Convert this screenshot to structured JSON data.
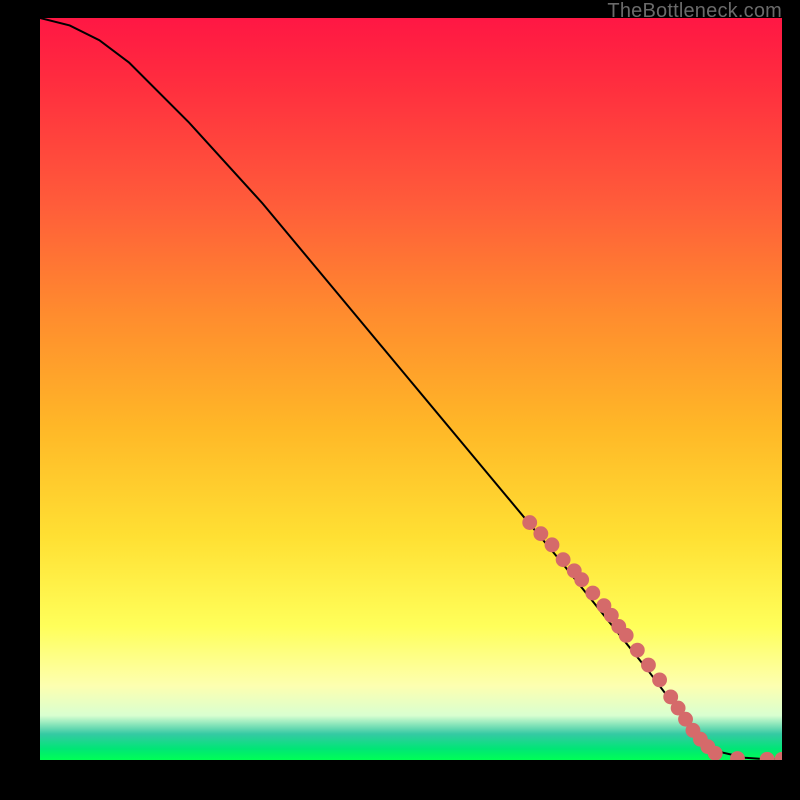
{
  "attribution": "TheBottleneck.com",
  "chart_data": {
    "type": "line",
    "title": "",
    "xlabel": "",
    "ylabel": "",
    "xlim": [
      0,
      100
    ],
    "ylim": [
      0,
      100
    ],
    "grid": false,
    "legend": false,
    "series": [
      {
        "name": "curve",
        "color": "#000000",
        "x": [
          0,
          4,
          8,
          12,
          20,
          30,
          40,
          50,
          60,
          70,
          78,
          82,
          85,
          88,
          90,
          92,
          95,
          98,
          100
        ],
        "y": [
          100,
          99,
          97,
          94,
          86,
          75,
          63,
          51,
          39,
          27,
          17,
          12,
          8,
          4,
          2,
          1,
          0.3,
          0.1,
          0.1
        ]
      },
      {
        "name": "highlight-dots",
        "color": "#d56a6a",
        "type": "scatter",
        "x": [
          66,
          67.5,
          69,
          70.5,
          72,
          73,
          74.5,
          76,
          77,
          78,
          79,
          80.5,
          82,
          83.5,
          85,
          86,
          87,
          88,
          89,
          90,
          91,
          94,
          98,
          100
        ],
        "y": [
          32,
          30.5,
          29,
          27,
          25.5,
          24.3,
          22.5,
          20.8,
          19.5,
          18,
          16.8,
          14.8,
          12.8,
          10.8,
          8.5,
          7,
          5.5,
          4,
          2.8,
          1.8,
          0.9,
          0.2,
          0.1,
          0.1
        ]
      }
    ]
  }
}
